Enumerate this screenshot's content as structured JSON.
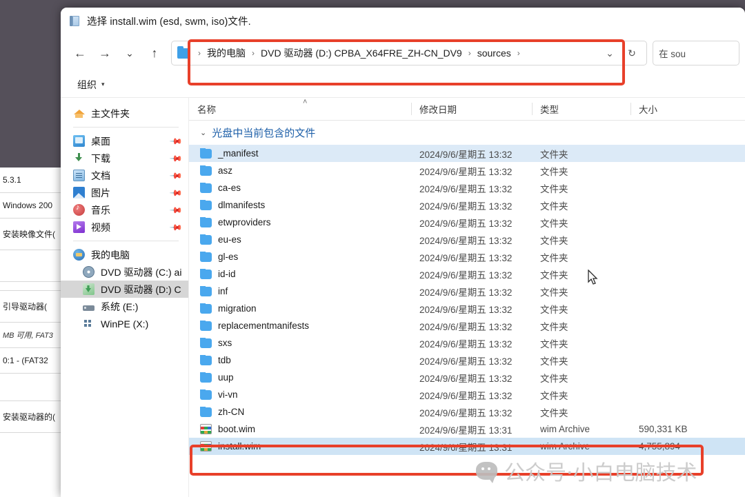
{
  "background_window": {
    "rows": [
      {
        "text": "5.3.1",
        "kind": "text"
      },
      {
        "text": "Windows 200",
        "kind": "text"
      },
      {
        "text": "安装映像文件(",
        "kind": "text"
      },
      {
        "text": "",
        "kind": "blank"
      },
      {
        "text": "引导驱动器(",
        "kind": "text"
      },
      {
        "text": "MB 可用, FAT3",
        "kind": "italic"
      },
      {
        "text": "0:1 -  (FAT32",
        "kind": "text"
      },
      {
        "text": "安装驱动器的(",
        "kind": "text"
      }
    ]
  },
  "dialog": {
    "title": "选择 install.wim (esd, swm, iso)文件.",
    "title_icon": "book-icon",
    "nav": {
      "back_icon": "arrow-left-icon",
      "forward_icon": "arrow-right-icon",
      "recent_icon": "chevron-down-icon",
      "up_icon": "arrow-up-icon"
    },
    "address": {
      "folder_icon": "folder-icon",
      "crumbs": [
        "我的电脑",
        "DVD 驱动器 (D:) CPBA_X64FRE_ZH-CN_DV9",
        "sources"
      ],
      "separator": "›",
      "history_icon": "chevron-down-icon",
      "refresh_icon": "refresh-icon"
    },
    "search": {
      "text": "在 sou"
    },
    "toolbar": {
      "organize_label": "组织",
      "organize_caret": "▾"
    }
  },
  "sidebar": {
    "home": {
      "label": "主文件夹",
      "icon": "home-icon"
    },
    "quick_access": [
      {
        "label": "桌面",
        "icon": "desktop-icon",
        "pinned": true
      },
      {
        "label": "下载",
        "icon": "download-icon",
        "pinned": true
      },
      {
        "label": "文档",
        "icon": "documents-icon",
        "pinned": true
      },
      {
        "label": "图片",
        "icon": "pictures-icon",
        "pinned": true
      },
      {
        "label": "音乐",
        "icon": "music-icon",
        "pinned": true
      },
      {
        "label": "视频",
        "icon": "video-icon",
        "pinned": true
      }
    ],
    "this_pc": {
      "label": "我的电脑",
      "icon": "this-pc-icon"
    },
    "drives": [
      {
        "label": "DVD 驱动器 (C:) ai",
        "icon": "cd-drive-icon",
        "selected": false
      },
      {
        "label": "DVD 驱动器 (D:) C",
        "icon": "cd-drive-green-icon",
        "selected": true
      },
      {
        "label": "系统 (E:)",
        "icon": "hard-disk-icon",
        "selected": false
      },
      {
        "label": "WinPE (X:)",
        "icon": "winpe-icon",
        "selected": false
      }
    ],
    "pin_icon": "pin-icon"
  },
  "file_list": {
    "columns": [
      {
        "label": "名称",
        "key": "name"
      },
      {
        "label": "修改日期",
        "key": "date"
      },
      {
        "label": "类型",
        "key": "type"
      },
      {
        "label": "大小",
        "key": "size"
      }
    ],
    "sort_indicator": "˄",
    "group_header": {
      "label": "光盘中当前包含的文件",
      "caret": "⌄"
    },
    "rows": [
      {
        "name": "_manifest",
        "date": "2024/9/6/星期五 13:32",
        "type": "文件夹",
        "size": "",
        "icon": "folder-icon",
        "selected": true
      },
      {
        "name": "asz",
        "date": "2024/9/6/星期五 13:32",
        "type": "文件夹",
        "size": "",
        "icon": "folder-icon",
        "selected": false
      },
      {
        "name": "ca-es",
        "date": "2024/9/6/星期五 13:32",
        "type": "文件夹",
        "size": "",
        "icon": "folder-icon",
        "selected": false
      },
      {
        "name": "dlmanifests",
        "date": "2024/9/6/星期五 13:32",
        "type": "文件夹",
        "size": "",
        "icon": "folder-icon",
        "selected": false
      },
      {
        "name": "etwproviders",
        "date": "2024/9/6/星期五 13:32",
        "type": "文件夹",
        "size": "",
        "icon": "folder-icon",
        "selected": false
      },
      {
        "name": "eu-es",
        "date": "2024/9/6/星期五 13:32",
        "type": "文件夹",
        "size": "",
        "icon": "folder-icon",
        "selected": false
      },
      {
        "name": "gl-es",
        "date": "2024/9/6/星期五 13:32",
        "type": "文件夹",
        "size": "",
        "icon": "folder-icon",
        "selected": false
      },
      {
        "name": "id-id",
        "date": "2024/9/6/星期五 13:32",
        "type": "文件夹",
        "size": "",
        "icon": "folder-icon",
        "selected": false
      },
      {
        "name": "inf",
        "date": "2024/9/6/星期五 13:32",
        "type": "文件夹",
        "size": "",
        "icon": "folder-icon",
        "selected": false
      },
      {
        "name": "migration",
        "date": "2024/9/6/星期五 13:32",
        "type": "文件夹",
        "size": "",
        "icon": "folder-icon",
        "selected": false
      },
      {
        "name": "replacementmanifests",
        "date": "2024/9/6/星期五 13:32",
        "type": "文件夹",
        "size": "",
        "icon": "folder-icon",
        "selected": false
      },
      {
        "name": "sxs",
        "date": "2024/9/6/星期五 13:32",
        "type": "文件夹",
        "size": "",
        "icon": "folder-icon",
        "selected": false
      },
      {
        "name": "tdb",
        "date": "2024/9/6/星期五 13:32",
        "type": "文件夹",
        "size": "",
        "icon": "folder-icon",
        "selected": false
      },
      {
        "name": "uup",
        "date": "2024/9/6/星期五 13:32",
        "type": "文件夹",
        "size": "",
        "icon": "folder-icon",
        "selected": false
      },
      {
        "name": "vi-vn",
        "date": "2024/9/6/星期五 13:32",
        "type": "文件夹",
        "size": "",
        "icon": "folder-icon",
        "selected": false
      },
      {
        "name": "zh-CN",
        "date": "2024/9/6/星期五 13:32",
        "type": "文件夹",
        "size": "",
        "icon": "folder-icon",
        "selected": false
      },
      {
        "name": "boot.wim",
        "date": "2024/9/6/星期五 13:31",
        "type": "wim Archive",
        "size": "590,331 KB",
        "icon": "wim-archive-icon",
        "selected": false
      },
      {
        "name": "install.wim",
        "date": "2024/9/6/星期五 13:31",
        "type": "wim Archive",
        "size": "4,755,894",
        "icon": "wim-archive-icon",
        "selected": true
      }
    ]
  },
  "annotations": {
    "color": "#e8402a",
    "boxes": [
      "address-bar",
      "install-wim-row"
    ]
  },
  "watermark": {
    "text": "公众号·小白电脑技术",
    "icon": "wechat-icon"
  }
}
